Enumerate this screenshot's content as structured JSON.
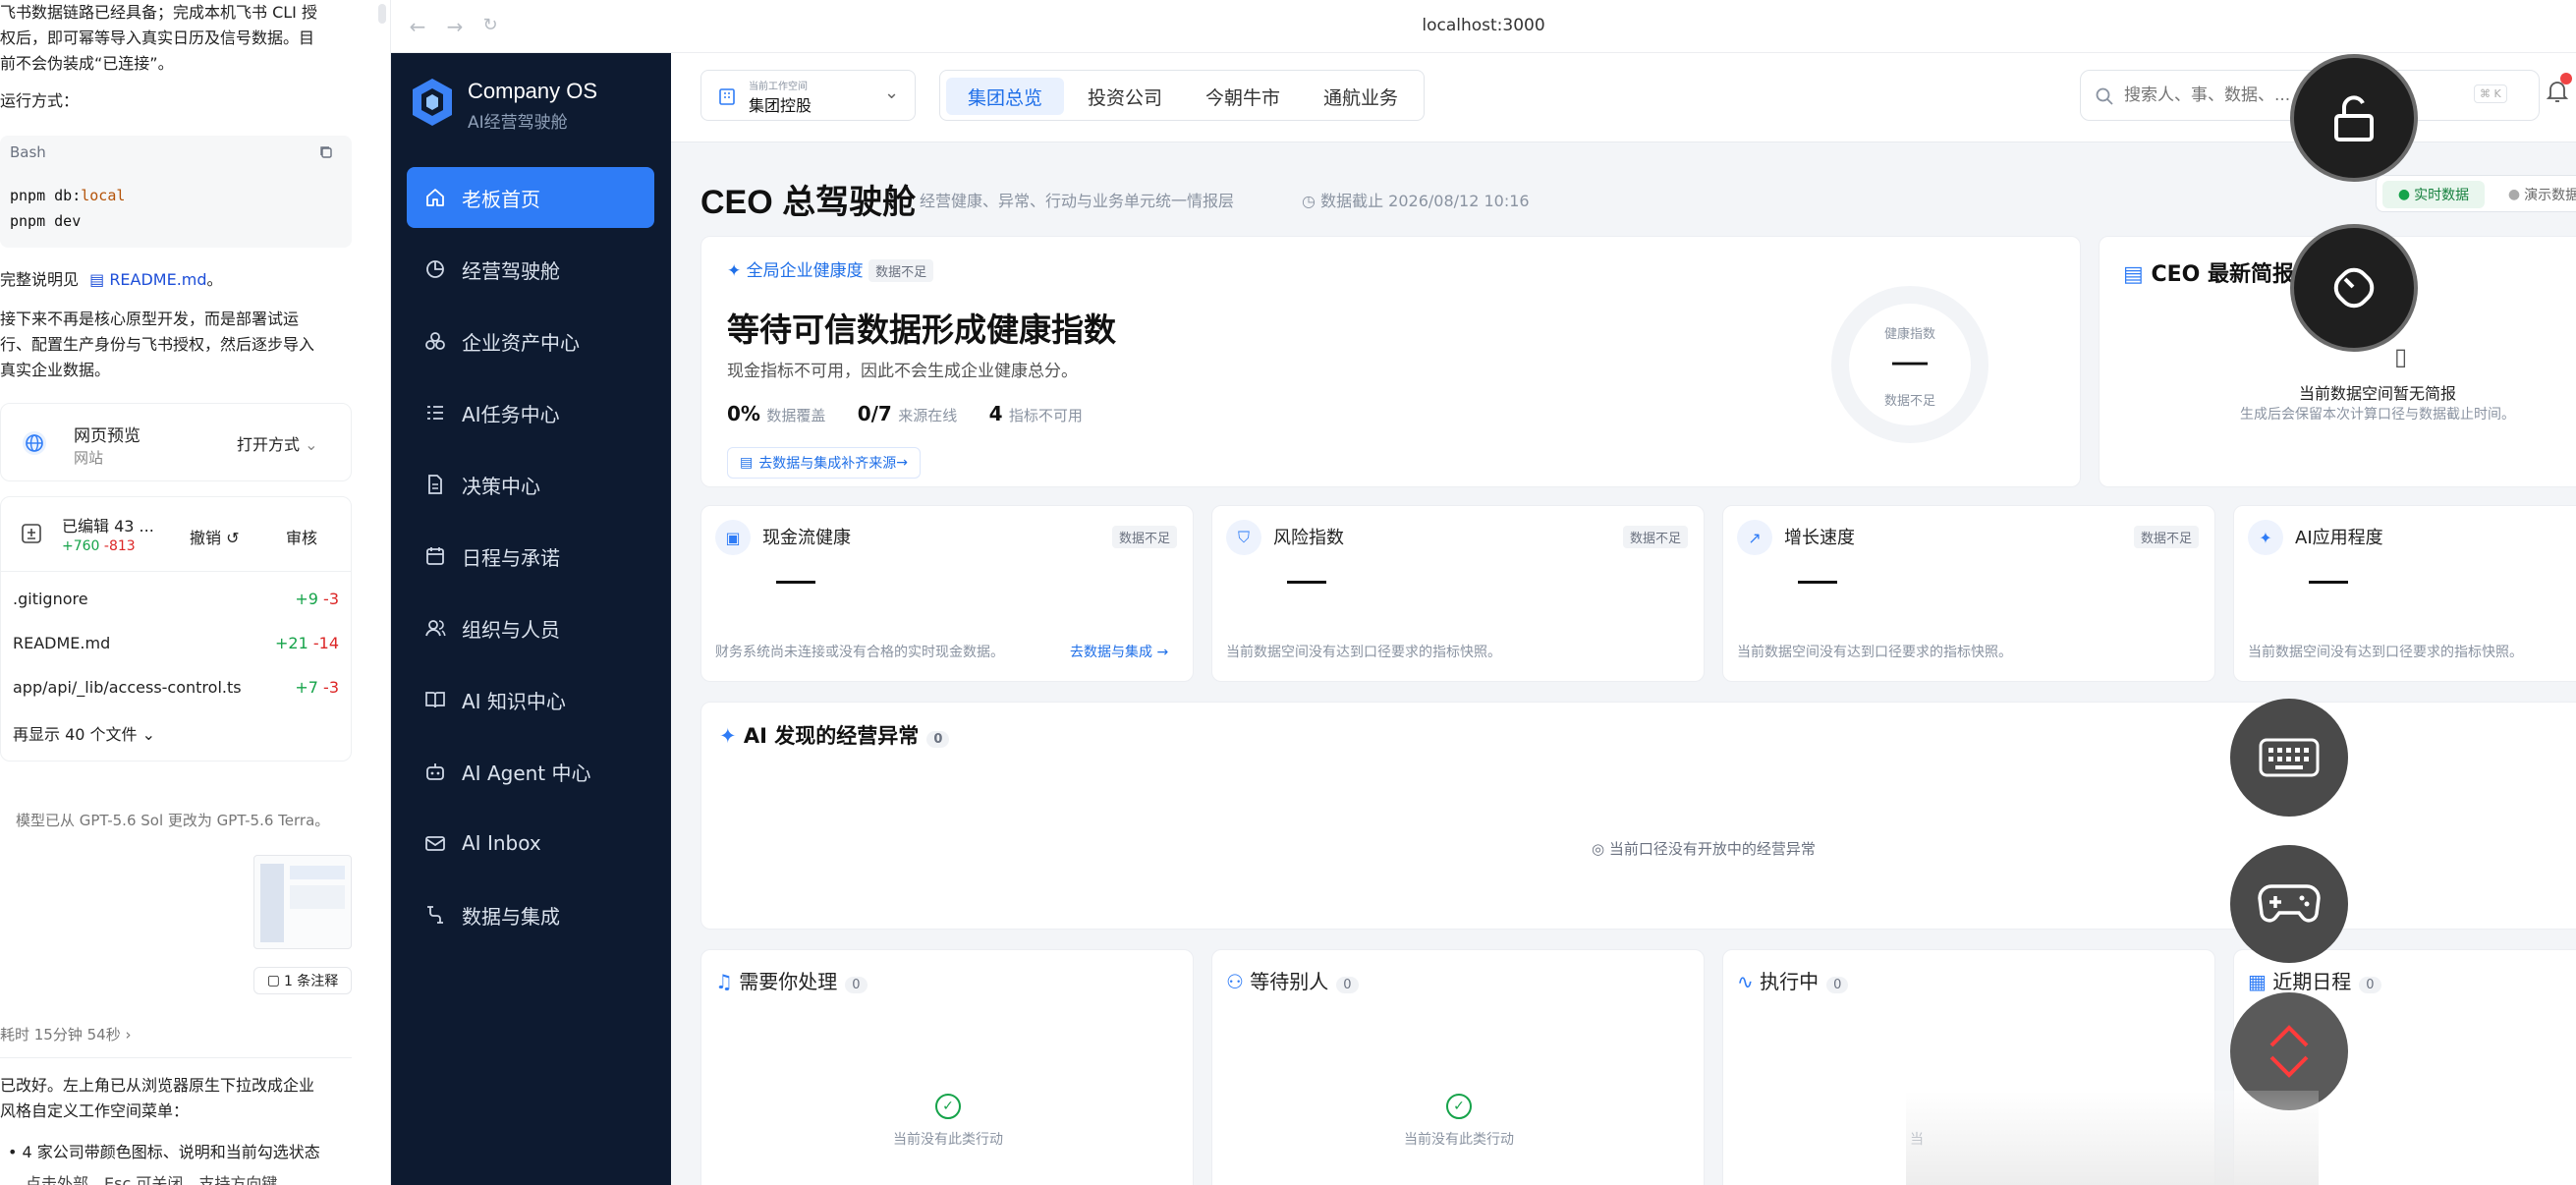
{
  "chat": {
    "intro_lines": [
      "飞书数据链路已经具备；完成本机飞书 CLI 授",
      "权后，即可幂等导入真实日历及信号数据。目",
      "前不会伪装成“已连接”。"
    ],
    "run_label": "运行方式：",
    "code_lang": "Bash",
    "code_line1_cmd": "pnpm db:",
    "code_line1_arg": "local",
    "code_line2": "pnpm dev",
    "readme_prefix": "完整说明见",
    "readme_link": "README.md",
    "readme_suffix": "。",
    "next_lines": [
      "接下来不再是核心原型开发，而是部署试运",
      "行、配置生产身份与飞书授权，然后逐步导入",
      "真实企业数据。"
    ],
    "preview_title": "网页预览",
    "preview_sub": "网站",
    "preview_open": "打开方式",
    "edited_title": "已编辑 43 ...",
    "edited_plus": "+760",
    "edited_minus": "-813",
    "undo": "撤销",
    "review": "审核",
    "files": [
      {
        "name": ".gitignore",
        "plus": "+9",
        "minus": "-3"
      },
      {
        "name": "README.md",
        "plus": "+21",
        "minus": "-14"
      },
      {
        "name": "app/api/_lib/access-control.ts",
        "plus": "+7",
        "minus": "-3"
      }
    ],
    "more_files": "再显示 40 个文件",
    "model_note": "模型已从 GPT-5.6 Sol 更改为 GPT-5.6 Terra。",
    "annotation": "1 条注释",
    "elapsed": "耗时 15分钟 54秒",
    "reply_lines": [
      "已改好。左上角已从浏览器原生下拉改成企业",
      "风格自定义工作空间菜单："
    ],
    "bullet": "4 家公司带颜色图标、说明和当前勾选状态",
    "bullet_cut": "点击外部、Esc 可关闭，支持方向键..."
  },
  "browser": {
    "url": "localhost:3000"
  },
  "sidebar": {
    "brand": "Company OS",
    "subtitle": "AI经营驾驶舱",
    "items": [
      {
        "label": "老板首页",
        "icon": "home-icon"
      },
      {
        "label": "经营驾驶舱",
        "icon": "pie-chart-icon"
      },
      {
        "label": "企业资产中心",
        "icon": "boxes-icon"
      },
      {
        "label": "AI任务中心",
        "icon": "task-list-icon"
      },
      {
        "label": "决策中心",
        "icon": "document-icon"
      },
      {
        "label": "日程与承诺",
        "icon": "calendar-icon"
      },
      {
        "label": "组织与人员",
        "icon": "users-icon"
      },
      {
        "label": "AI 知识中心",
        "icon": "book-icon"
      },
      {
        "label": "AI Agent 中心",
        "icon": "bot-icon"
      },
      {
        "label": "AI Inbox",
        "icon": "inbox-icon"
      },
      {
        "label": "数据与集成",
        "icon": "integration-icon"
      }
    ]
  },
  "topbar": {
    "ws_caption": "当前工作空间",
    "ws_name": "集团控股",
    "tabs": [
      "集团总览",
      "投资公司",
      "今朝牛市",
      "通航业务"
    ],
    "search_placeholder": "搜索人、事、数据、...",
    "search_shortcut": "⌘ K"
  },
  "header": {
    "title": "CEO 总驾驶舱",
    "subtitle": "经营健康、异常、行动与业务单元统一情报层",
    "data_time": "数据截止 2026/08/12 10:16",
    "mode_live": "实时数据",
    "mode_demo": "演示数据"
  },
  "health": {
    "label": "全局企业健康度",
    "badge": "数据不足",
    "headline": "等待可信数据形成健康指数",
    "desc": "现金指标不可用，因此不会生成企业健康总分。",
    "m1_value": "0%",
    "m1_label": "数据覆盖",
    "m2_value": "0/7",
    "m2_label": "来源在线",
    "m3_value": "4",
    "m3_label": "指标不可用",
    "link": "去数据与集成补齐来源",
    "gauge_title": "健康指数",
    "gauge_value": "—",
    "gauge_status": "数据不足"
  },
  "brief": {
    "title": "CEO 最新简报",
    "empty": "当前数据空间暂无简报",
    "hint": "生成后会保留本次计算口径与数据截止时间。"
  },
  "kpis": [
    {
      "title": "现金流健康",
      "badge": "数据不足",
      "value": "—",
      "note": "财务系统尚未连接或没有合格的实时现金数据。",
      "link": "去数据与集成"
    },
    {
      "title": "风险指数",
      "badge": "数据不足",
      "value": "—",
      "note": "当前数据空间没有达到口径要求的指标快照。",
      "link": ""
    },
    {
      "title": "增长速度",
      "badge": "数据不足",
      "value": "—",
      "note": "当前数据空间没有达到口径要求的指标快照。",
      "link": ""
    },
    {
      "title": "AI应用程度",
      "badge": "",
      "value": "—",
      "note": "当前数据空间没有达到口径要求的指标快照。",
      "link": ""
    }
  ],
  "anomaly": {
    "title": "AI 发现的经营异常",
    "count": "0",
    "empty": "当前口径没有开放中的经营异常"
  },
  "lanes": [
    {
      "title": "需要你处理",
      "count": "0",
      "empty": "当前没有此类行动"
    },
    {
      "title": "等待别人",
      "count": "0",
      "empty": "当前没有此类行动"
    },
    {
      "title": "执行中",
      "count": "0",
      "empty": "当"
    },
    {
      "title": "近期日程",
      "count": "0",
      "empty": ""
    }
  ],
  "colors": {
    "accent": "#2f7cf6",
    "sidebar": "#0d1a30",
    "ok": "#16a34a"
  }
}
